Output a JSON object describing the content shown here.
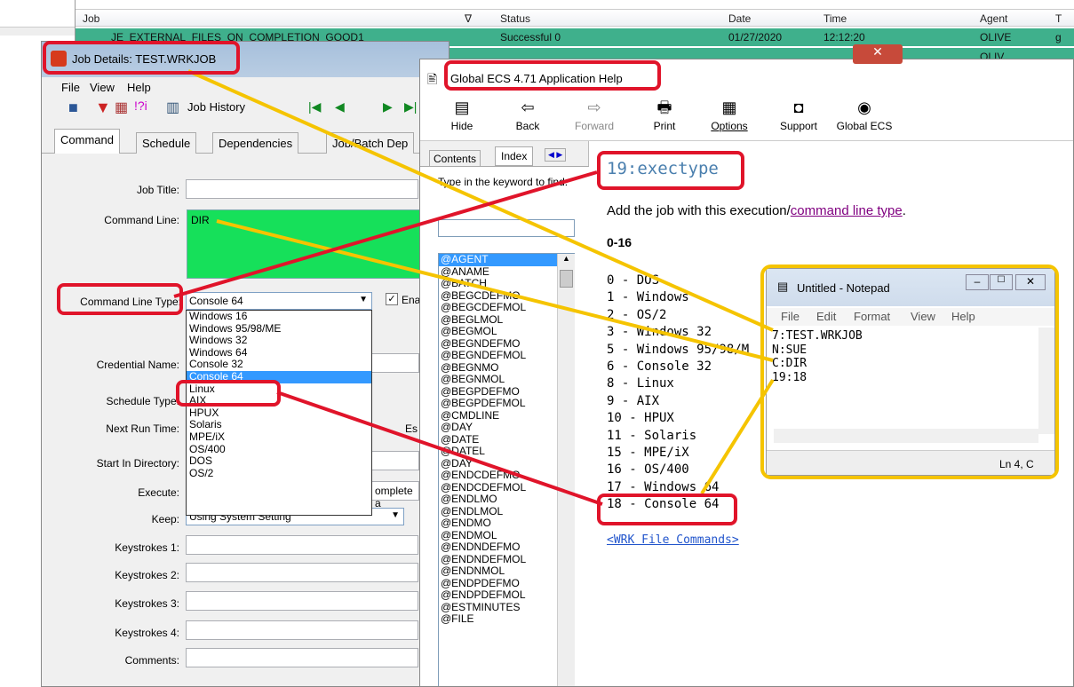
{
  "joblist": {
    "headers": {
      "job": "Job",
      "status": "Status",
      "date": "Date",
      "time": "Time",
      "agent": "Agent",
      "t": "T"
    },
    "row1": {
      "job": "JE_EXTERNAL_FILES_ON_COMPLETION_GOOD1",
      "status": "Successful 0",
      "date": "01/27/2020",
      "time": "12:12:20",
      "agent": "OLIVE",
      "t": "g"
    },
    "row2": {
      "agent": "OLIV"
    }
  },
  "jobdetails": {
    "title": "Job Details: TEST.WRKJOB",
    "menu": [
      "File",
      "View",
      "Help"
    ],
    "job_history": "Job History",
    "tabs": [
      "Command",
      "Schedule",
      "Dependencies",
      "Job/Batch Dep"
    ],
    "labels": {
      "job_title": "Job Title:",
      "command_line": "Command Line:",
      "command_line_type": "Command Line Type:",
      "credential_name": "Credential Name:",
      "schedule_type": "Schedule Type:",
      "next_run_time": "Next Run Time:",
      "start_in_directory": "Start In Directory:",
      "execute": "Execute:",
      "keep": "Keep:",
      "keystrokes1": "Keystrokes 1:",
      "keystrokes2": "Keystrokes 2:",
      "keystrokes3": "Keystrokes 3:",
      "keystrokes4": "Keystrokes 4:",
      "comments": "Comments:"
    },
    "command_line_value": "DIR",
    "command_line_type_value": "Console 64",
    "enable_label": "Ena",
    "execute_value": "omplete a",
    "keep_value": "Using System Setting",
    "es_label": "Es",
    "dropdown_options": [
      "Windows 16",
      "Windows 95/98/ME",
      "Windows 32",
      "Windows 64",
      "Console 32",
      "Console 64",
      "Linux",
      "AIX",
      "HPUX",
      "Solaris",
      "MPE/iX",
      "OS/400",
      "DOS",
      "OS/2"
    ],
    "dropdown_selected": "Console 64"
  },
  "help": {
    "title": "Global ECS 4.71 Application Help",
    "toolbar": [
      {
        "label": "Hide",
        "icon": "▤"
      },
      {
        "label": "Back",
        "icon": "⇦"
      },
      {
        "label": "Forward",
        "icon": "⇨"
      },
      {
        "label": "Print",
        "icon": "🖶"
      },
      {
        "label": "Options",
        "icon": "▦"
      },
      {
        "label": "Support",
        "icon": "◘"
      },
      {
        "label": "Global ECS",
        "icon": "◉"
      }
    ],
    "nav_tabs": [
      "Contents",
      "Index"
    ],
    "keyword_prompt": "Type in the keyword to find:",
    "keywords": [
      "@AGENT",
      "@ANAME",
      "@BATCH",
      "@BEGCDEFMO",
      "@BEGCDEFMOL",
      "@BEGLMOL",
      "@BEGMOL",
      "@BEGNDEFMO",
      "@BEGNDEFMOL",
      "@BEGNMO",
      "@BEGNMOL",
      "@BEGPDEFMO",
      "@BEGPDEFMOL",
      "@CMDLINE",
      "@DAY",
      "@DATE",
      "@DATEL",
      "@DAY",
      "@ENDCDEFMO",
      "@ENDCDEFMOL",
      "@ENDLMO",
      "@ENDLMOL",
      "@ENDMO",
      "@ENDMOL",
      "@ENDNDEFMO",
      "@ENDNDEFMOL",
      "@ENDNMOL",
      "@ENDPDEFMO",
      "@ENDPDEFMOL",
      "@ESTMINUTES",
      "@FILE"
    ],
    "heading": "19:exectype",
    "description_prefix": "Add the job with this execution/",
    "description_link": "command line type",
    "description_suffix": ".",
    "range": "0-16",
    "types": [
      "0 - DOS",
      "1 - Windows",
      "2 - OS/2",
      "3 - Windows 32",
      "5 - Windows 95/98/M",
      "6 - Console 32",
      "8 - Linux",
      "9 - AIX",
      "10 - HPUX",
      "11 - Solaris",
      "15 - MPE/iX",
      "16 - OS/400",
      "17 - Windows 64",
      "18 - Console 64"
    ],
    "footer_link": "<WRK File Commands>"
  },
  "notepad": {
    "title": "Untitled - Notepad",
    "menu": [
      "File",
      "Edit",
      "Format",
      "View",
      "Help"
    ],
    "lines": [
      "7:TEST.WRKJOB",
      "N:SUE",
      "C:DIR",
      "19:18"
    ],
    "status": "Ln 4, C"
  },
  "colors": {
    "accent_red": "#e0142a",
    "accent_yellow": "#f5c400",
    "green_field": "#16e05a",
    "selected": "#3399ff"
  }
}
